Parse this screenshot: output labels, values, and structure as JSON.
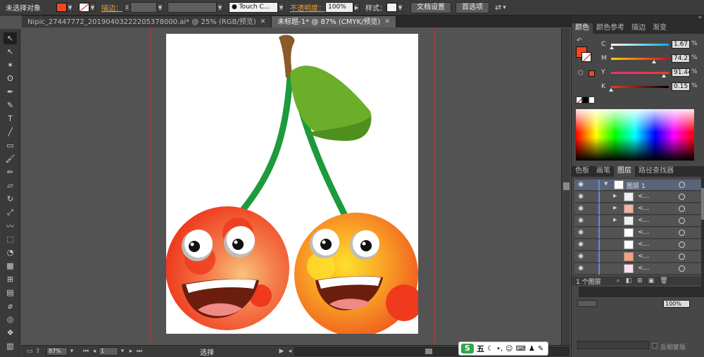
{
  "control_bar": {
    "selection_label": "未选择对象",
    "fill_color": "#f4471e",
    "stroke_label": "描边：",
    "brush_label": "Touch C...",
    "opacity_label": "不透明度：",
    "opacity_value": "100%",
    "style_label": "样式：",
    "doc_setup_button": "文档设置",
    "prefs_button": "首选项"
  },
  "tabs": [
    {
      "label": "Nipic_27447772_20190403222205378000.ai* @ 25% (RGB/预览)",
      "active": false
    },
    {
      "label": "未标题-1* @ 87% (CMYK/预览)",
      "active": true
    }
  ],
  "toolbar": {
    "tools": [
      {
        "icon": "selection-tool-icon",
        "glyph": "↖"
      },
      {
        "icon": "direct-selection-tool-icon",
        "glyph": "↖"
      },
      {
        "icon": "magic-wand-tool-icon",
        "glyph": "✶"
      },
      {
        "icon": "lasso-tool-icon",
        "glyph": "ʘ"
      },
      {
        "icon": "pen-tool-icon",
        "glyph": "✒"
      },
      {
        "icon": "curvature-tool-icon",
        "glyph": "✎"
      },
      {
        "icon": "type-tool-icon",
        "glyph": "T"
      },
      {
        "icon": "line-tool-icon",
        "glyph": "╱"
      },
      {
        "icon": "rectangle-tool-icon",
        "glyph": "▭"
      },
      {
        "icon": "paintbrush-tool-icon",
        "glyph": "🖌"
      },
      {
        "icon": "pencil-tool-icon",
        "glyph": "✏"
      },
      {
        "icon": "eraser-tool-icon",
        "glyph": "▱"
      },
      {
        "icon": "rotate-tool-icon",
        "glyph": "↻"
      },
      {
        "icon": "scale-tool-icon",
        "glyph": "⤢"
      },
      {
        "icon": "warp-tool-icon",
        "glyph": "〰"
      },
      {
        "icon": "free-transform-tool-icon",
        "glyph": "⬚"
      },
      {
        "icon": "shape-builder-tool-icon",
        "glyph": "◔"
      },
      {
        "icon": "perspective-grid-tool-icon",
        "glyph": "▦"
      },
      {
        "icon": "mesh-tool-icon",
        "glyph": "⊞"
      },
      {
        "icon": "gradient-tool-icon",
        "glyph": "▤"
      },
      {
        "icon": "eyedropper-tool-icon",
        "glyph": "⌀"
      },
      {
        "icon": "blend-tool-icon",
        "glyph": "◎"
      },
      {
        "icon": "symbol-sprayer-tool-icon",
        "glyph": "❖"
      },
      {
        "icon": "column-graph-tool-icon",
        "glyph": "▥"
      }
    ]
  },
  "status_bar": {
    "zoom": "87%",
    "page": "1",
    "tool_status": "选择"
  },
  "ime_bar": {
    "logo": "S",
    "mode": "五"
  },
  "color_panel": {
    "tabs": [
      "颜色",
      "颜色参考",
      "描边",
      "渐变"
    ],
    "channels": [
      {
        "label": "C",
        "value": "1.67",
        "percent": 1.67,
        "gradient": "linear-gradient(to right,#fff,#00aeef)"
      },
      {
        "label": "M",
        "value": "74.21",
        "percent": 74.21,
        "gradient": "linear-gradient(to right,#ffd200,#e8002a)"
      },
      {
        "label": "Y",
        "value": "91.44",
        "percent": 91.44,
        "gradient": "linear-gradient(to right,#e62d8c,#f23b1a)"
      },
      {
        "label": "K",
        "value": "0.15",
        "percent": 0.15,
        "gradient": "linear-gradient(to right,#f23b1a,#000)"
      }
    ],
    "percent_sign": "%"
  },
  "layers_panel": {
    "tabs": [
      "色板",
      "画笔",
      "图层",
      "路径查找器"
    ],
    "layer_name": "图层 1",
    "sublayers": [
      "<...",
      "<...",
      "<...",
      "<...",
      "<...",
      "<...",
      "<..."
    ],
    "footer_count": "1 个图层"
  },
  "bottom_panel": {
    "opacity_value": "100%",
    "invert_mask_label": "反相蒙版"
  },
  "colors": {
    "cherry_red": "#f23b1a",
    "cherry_orange": "#f79b20",
    "stem_green": "#1d9a3c",
    "leaf_green": "#6aae2a",
    "stem_brown": "#8a5a2a"
  }
}
